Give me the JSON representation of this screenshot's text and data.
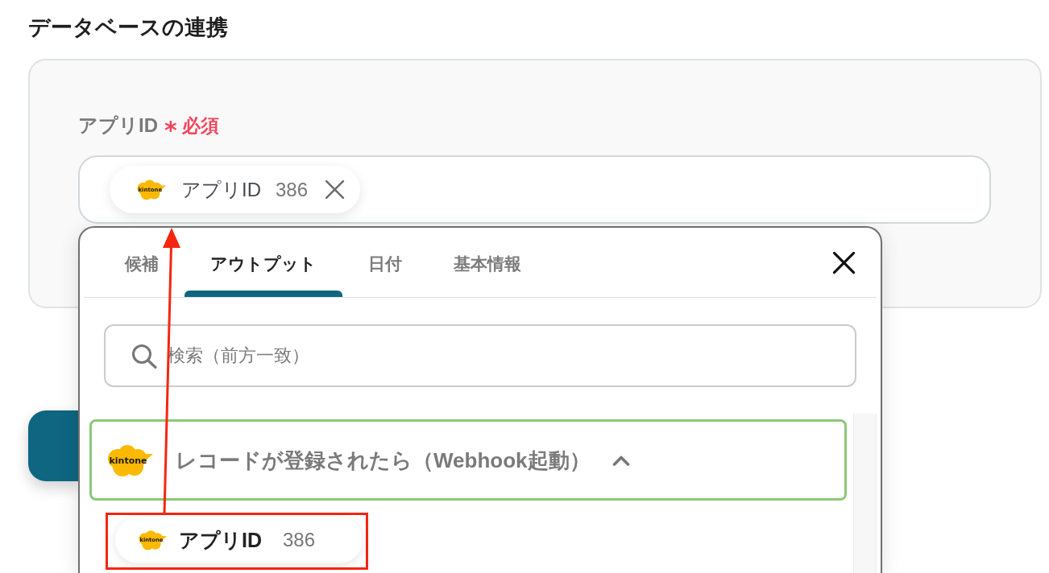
{
  "section": {
    "title": "データベースの連携"
  },
  "field": {
    "label": "アプリID",
    "required_mark": "*",
    "required_text": "必須",
    "tokens": [
      {
        "logo": "kintone",
        "label": "アプリID",
        "value": "386"
      }
    ]
  },
  "popup": {
    "tabs": [
      {
        "label": "候補",
        "selected": false
      },
      {
        "label": "アウトプット",
        "selected": true
      },
      {
        "label": "日付",
        "selected": false
      },
      {
        "label": "基本情報",
        "selected": false
      }
    ],
    "search": {
      "placeholder": "検索（前方一致）"
    },
    "groups": [
      {
        "logo": "kintone",
        "title": "レコードが登録されたら（Webhook起動）",
        "expanded": true,
        "items": [
          {
            "logo": "kintone",
            "label": "アプリID",
            "value": "386",
            "highlighted": true
          }
        ]
      }
    ]
  },
  "annotations": [
    {
      "kind": "arrow"
    }
  ]
}
